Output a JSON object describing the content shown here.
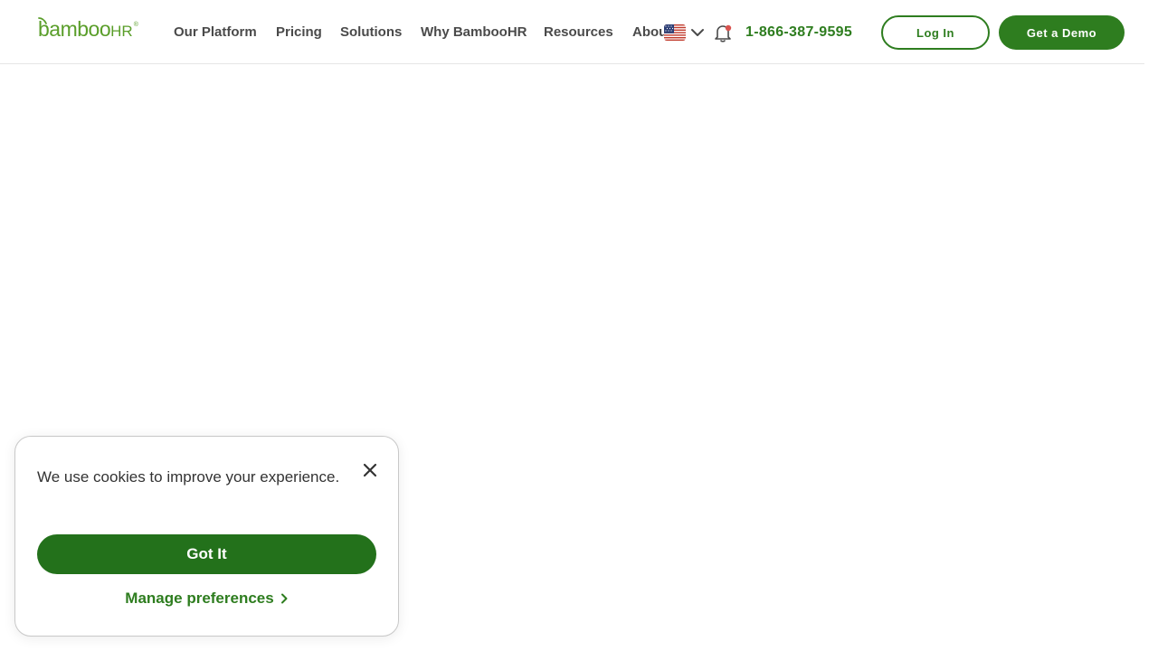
{
  "header": {
    "logo": {
      "main": "bamboo",
      "suffix": "HR",
      "reg": "®"
    },
    "nav": [
      {
        "label": "Our Platform"
      },
      {
        "label": "Pricing"
      },
      {
        "label": "Solutions"
      },
      {
        "label": "Why BambooHR"
      },
      {
        "label": "Resources"
      },
      {
        "label": "About"
      }
    ],
    "language_icon": "us-flag-icon",
    "notification_icon": "bell-icon",
    "phone": "1-866-387-9595",
    "login_label": "Log In",
    "demo_label": "Get a Demo"
  },
  "cookie_banner": {
    "message": "We use cookies to improve your experience.",
    "accept_label": "Got It",
    "manage_label": "Manage preferences",
    "close_icon": "close-icon"
  },
  "colors": {
    "brand_green": "#2e7d1f",
    "accept_green": "#23711b",
    "logo_green": "#5a9e2a",
    "notification_dot": "#d9534f",
    "nav_text": "#4a4a4a"
  }
}
